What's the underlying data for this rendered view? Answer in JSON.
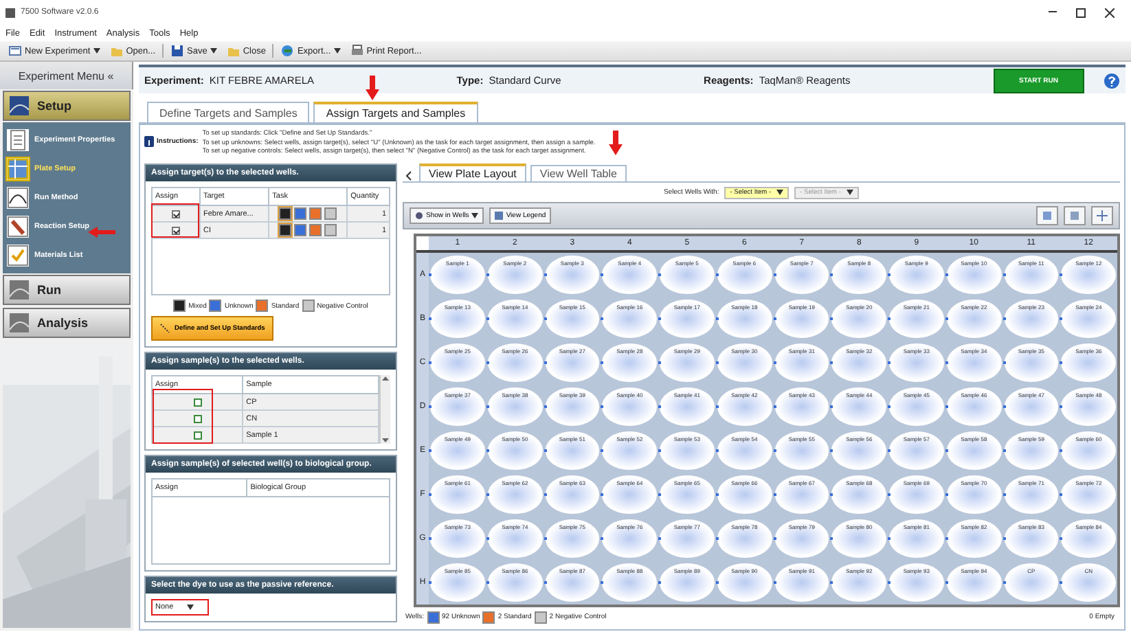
{
  "window": {
    "title": "7500 Software v2.0.6"
  },
  "menu": [
    "File",
    "Edit",
    "Instrument",
    "Analysis",
    "Tools",
    "Help"
  ],
  "toolbar": [
    {
      "label": "New Experiment",
      "dropdown": true
    },
    {
      "label": "Open...",
      "dropdown": false
    },
    {
      "label": "Save",
      "dropdown": true
    },
    {
      "label": "Close",
      "dropdown": false
    },
    {
      "label": "Export...",
      "dropdown": true
    },
    {
      "label": "Print Report...",
      "dropdown": false
    }
  ],
  "sidebar": {
    "title": "Experiment Menu «",
    "sections": [
      {
        "label": "Setup",
        "selected": true,
        "items": [
          {
            "label": "Experiment Properties",
            "selected": false
          },
          {
            "label": "Plate Setup",
            "selected": true
          },
          {
            "label": "Run Method",
            "selected": false
          },
          {
            "label": "Reaction Setup",
            "selected": false
          },
          {
            "label": "Materials List",
            "selected": false
          }
        ]
      },
      {
        "label": "Run",
        "selected": false
      },
      {
        "label": "Analysis",
        "selected": false
      }
    ]
  },
  "experiment": {
    "name_label": "Experiment:",
    "name": "KIT FEBRE AMARELA",
    "type_label": "Type:",
    "type": "Standard Curve",
    "reagents_label": "Reagents:",
    "reagents": "TaqMan® Reagents",
    "start_button": "START RUN"
  },
  "tabs": [
    {
      "label": "Define Targets and Samples",
      "selected": false
    },
    {
      "label": "Assign Targets and Samples",
      "selected": true
    }
  ],
  "instructions": {
    "label": "Instructions:",
    "lines": [
      "To set up standards: Click \"Define and Set Up Standards.\"",
      "To set up unknowns: Select wells, assign target(s), select \"U\" (Unknown) as the task for each target assignment, then assign a sample.",
      "To set up negative controls: Select wells, assign target(s), then select \"N\" (Negative Control) as the task for each target assignment."
    ]
  },
  "tasks": [
    {
      "label": "Mixed",
      "color": "#222222"
    },
    {
      "label": "Unknown",
      "color": "#3a6fd8"
    },
    {
      "label": "Standard",
      "color": "#e8702a"
    },
    {
      "label": "Negative Control",
      "color": "#c8c8c8"
    }
  ],
  "targets_panel": {
    "title": "Assign target(s) to the selected wells.",
    "columns": [
      "Assign",
      "Target",
      "Task",
      "Quantity"
    ],
    "rows": [
      {
        "checked": true,
        "target": "Febre Amare...",
        "quantity": "1"
      },
      {
        "checked": true,
        "target": "CI",
        "quantity": "1"
      }
    ],
    "button": "Define and Set Up Standards"
  },
  "samples_panel": {
    "title": "Assign sample(s) to the selected wells.",
    "columns": [
      "Assign",
      "Sample"
    ],
    "rows": [
      {
        "checked": false,
        "sample": "CP"
      },
      {
        "checked": false,
        "sample": "CN"
      },
      {
        "checked": false,
        "sample": "Sample 1"
      }
    ]
  },
  "groups_panel": {
    "title": "Assign sample(s) of selected well(s) to biological group.",
    "columns": [
      "Assign",
      "Biological Group"
    ]
  },
  "dye_panel": {
    "title": "Select the dye to use as the passive reference.",
    "value": "None"
  },
  "plate": {
    "tabs": [
      {
        "label": "View Plate Layout",
        "selected": true
      },
      {
        "label": "View Well Table",
        "selected": false
      }
    ],
    "select_label": "Select Wells With:",
    "selects": [
      {
        "value": "- Select Item -",
        "disabled": false
      },
      {
        "value": "- Select Item -",
        "disabled": true
      }
    ],
    "show_button": "Show in Wells",
    "legend_button": "View Legend",
    "columns": [
      "1",
      "2",
      "3",
      "4",
      "5",
      "6",
      "7",
      "8",
      "9",
      "10",
      "11",
      "12"
    ],
    "rows": [
      "A",
      "B",
      "C",
      "D",
      "E",
      "F",
      "G",
      "H"
    ],
    "wells": [
      "Sample 1",
      "Sample 2",
      "Sample 3",
      "Sample 4",
      "Sample 5",
      "Sample 6",
      "Sample 7",
      "Sample 8",
      "Sample 9",
      "Sample 10",
      "Sample 11",
      "Sample 12",
      "Sample 13",
      "Sample 14",
      "Sample 15",
      "Sample 16",
      "Sample 17",
      "Sample 18",
      "Sample 19",
      "Sample 20",
      "Sample 21",
      "Sample 22",
      "Sample 23",
      "Sample 24",
      "Sample 25",
      "Sample 26",
      "Sample 27",
      "Sample 28",
      "Sample 29",
      "Sample 30",
      "Sample 31",
      "Sample 32",
      "Sample 33",
      "Sample 34",
      "Sample 35",
      "Sample 36",
      "Sample 37",
      "Sample 38",
      "Sample 39",
      "Sample 40",
      "Sample 41",
      "Sample 42",
      "Sample 43",
      "Sample 44",
      "Sample 45",
      "Sample 46",
      "Sample 47",
      "Sample 48",
      "Sample 49",
      "Sample 50",
      "Sample 51",
      "Sample 52",
      "Sample 53",
      "Sample 54",
      "Sample 55",
      "Sample 56",
      "Sample 57",
      "Sample 58",
      "Sample 59",
      "Sample 60",
      "Sample 61",
      "Sample 62",
      "Sample 63",
      "Sample 64",
      "Sample 65",
      "Sample 66",
      "Sample 67",
      "Sample 68",
      "Sample 69",
      "Sample 70",
      "Sample 71",
      "Sample 72",
      "Sample 73",
      "Sample 74",
      "Sample 75",
      "Sample 76",
      "Sample 77",
      "Sample 78",
      "Sample 79",
      "Sample 80",
      "Sample 81",
      "Sample 82",
      "Sample 83",
      "Sample 84",
      "Sample 85",
      "Sample 86",
      "Sample 87",
      "Sample 88",
      "Sample 89",
      "Sample 90",
      "Sample 91",
      "Sample 92",
      "Sample 93",
      "Sample 94",
      "CP",
      "CN"
    ],
    "footer_label": "Wells:",
    "counts": [
      "92 Unknown",
      "2 Standard",
      "2 Negative Control"
    ],
    "empty": "0 Empty"
  }
}
